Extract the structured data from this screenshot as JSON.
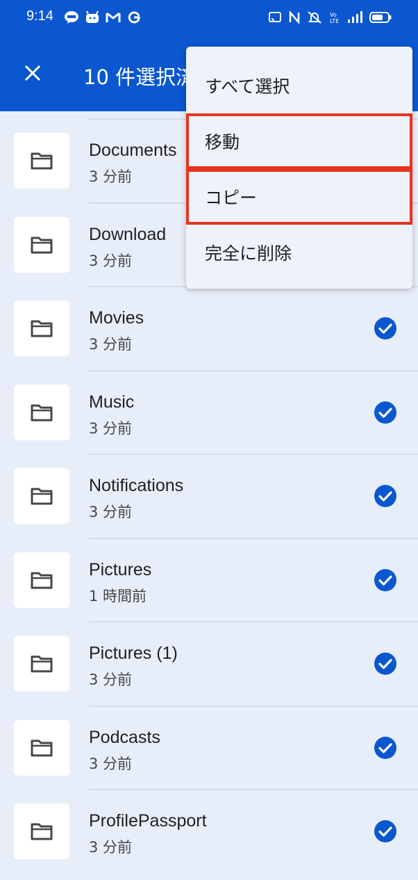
{
  "status_bar": {
    "time": "9:14",
    "left_icons": [
      "line-icon",
      "android-icon",
      "gmail-icon",
      "google-icon"
    ],
    "right_icons": [
      "cast-icon",
      "nfc-icon",
      "mute-icon",
      "volte-icon",
      "signal-icon",
      "battery-icon"
    ]
  },
  "header": {
    "title": "10 件選択済み"
  },
  "menu": {
    "items": [
      {
        "label": "すべて選択",
        "highlighted": false
      },
      {
        "label": "移動",
        "highlighted": true
      },
      {
        "label": "コピー",
        "highlighted": true
      },
      {
        "label": "完全に削除",
        "highlighted": false
      }
    ],
    "highlight_color": "#e8321e"
  },
  "files": [
    {
      "name": "Documents",
      "modified": "3 分前",
      "selected": true
    },
    {
      "name": "Download",
      "modified": "3 分前",
      "selected": true
    },
    {
      "name": "Movies",
      "modified": "3 分前",
      "selected": true
    },
    {
      "name": "Music",
      "modified": "3 分前",
      "selected": true
    },
    {
      "name": "Notifications",
      "modified": "3 分前",
      "selected": true
    },
    {
      "name": "Pictures",
      "modified": "1 時間前",
      "selected": true
    },
    {
      "name": "Pictures (1)",
      "modified": "3 分前",
      "selected": true
    },
    {
      "name": "Podcasts",
      "modified": "3 分前",
      "selected": true
    },
    {
      "name": "ProfilePassport",
      "modified": "3 分前",
      "selected": true
    }
  ],
  "colors": {
    "app_bar": "#0b57d0",
    "background": "#e8eef9",
    "check": "#0b57d0"
  }
}
